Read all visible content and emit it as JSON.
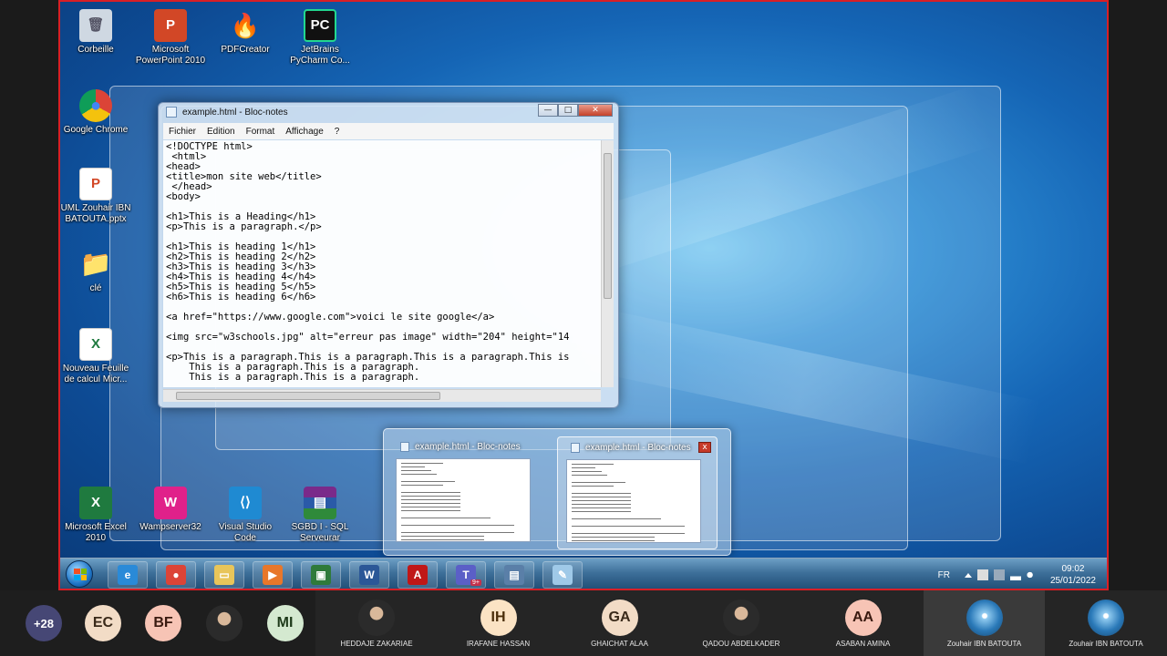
{
  "desktop": {
    "icons": [
      {
        "label": "Corbeille",
        "glyph": "🗑",
        "color": "#cfd8e2"
      },
      {
        "label": "Microsoft PowerPoint 2010",
        "glyph": "P",
        "color": "#d24726"
      },
      {
        "label": "PDFCreator",
        "glyph": "🔥",
        "color": "#c01717"
      },
      {
        "label": "JetBrains PyCharm Co...",
        "glyph": "PC",
        "color": "#1e1e1e"
      },
      {
        "label": "Google Chrome",
        "glyph": "●",
        "color": "#3b8de0"
      },
      {
        "label": "UML Zouhair IBN BATOUTA.pptx",
        "glyph": "P",
        "color": "#d24726"
      },
      {
        "label": "clé",
        "glyph": "📁",
        "color": "#e8c55a"
      },
      {
        "label": "Nouveau Feuille de calcul Micr...",
        "glyph": "X",
        "color": "#1f7a3f"
      },
      {
        "label": "Microsoft Excel 2010",
        "glyph": "X",
        "color": "#1f7a3f"
      },
      {
        "label": "Wampserver32",
        "glyph": "W",
        "color": "#e0218a"
      },
      {
        "label": "Visual Studio Code",
        "glyph": "⟨⟩",
        "color": "#1f8ad2"
      },
      {
        "label": "SGBD I - SQL Serveurar",
        "glyph": "▤",
        "color": "#7a2a8a"
      }
    ]
  },
  "notepad": {
    "title": "example.html - Bloc-notes",
    "menus": [
      "Fichier",
      "Edition",
      "Format",
      "Affichage",
      "?"
    ],
    "min_label": "—",
    "max_label": "□",
    "close_label": "✕",
    "content": "<!DOCTYPE html>\n <html>\n<head>\n<title>mon site web</title>\n </head>\n<body>\n\n<h1>This is a Heading</h1>\n<p>This is a paragraph.</p>\n\n<h1>This is heading 1</h1>\n<h2>This is heading 2</h2>\n<h3>This is heading 3</h3>\n<h4>This is heading 4</h4>\n<h5>This is heading 5</h5>\n<h6>This is heading 6</h6>\n\n<a href=\"https://www.google.com\">voici le site google</a>\n\n<img src=\"w3schools.jpg\" alt=\"erreur pas image\" width=\"204\" height=\"14\n\n<p>This is a paragraph.This is a paragraph.This is a paragraph.This is\n    This is a paragraph.This is a paragraph.\n    This is a paragraph.This is a paragraph."
  },
  "thumbnails": [
    {
      "title": "example.html - Bloc-notes"
    },
    {
      "title": "example.html - Bloc-notes",
      "close_label": "x"
    }
  ],
  "taskbar": {
    "apps": [
      {
        "name": "internet-explorer",
        "glyph": "e",
        "color": "#2a8ad8"
      },
      {
        "name": "google-chrome",
        "glyph": "●",
        "color": "#dc4437"
      },
      {
        "name": "file-explorer",
        "glyph": "▭",
        "color": "#e8c55a"
      },
      {
        "name": "media-player",
        "glyph": "▶",
        "color": "#e8772a"
      },
      {
        "name": "remote-console",
        "glyph": "▣",
        "color": "#2f7a3a"
      },
      {
        "name": "microsoft-word",
        "glyph": "W",
        "color": "#2b5797"
      },
      {
        "name": "pdf-reader",
        "glyph": "A",
        "color": "#c01717"
      },
      {
        "name": "microsoft-teams",
        "glyph": "T",
        "color": "#5b5fc7"
      },
      {
        "name": "network-tool",
        "glyph": "▤",
        "color": "#5a7fa8"
      },
      {
        "name": "notepad",
        "glyph": "✎",
        "color": "#9fc9e8"
      }
    ],
    "teams_badge": "9+",
    "lang": "FR",
    "time": "09:02",
    "date": "25/01/2022"
  },
  "meeting": {
    "overflow_count": "+28",
    "participants": [
      {
        "initials": "EC",
        "name": "",
        "bg": "#f2dcc6",
        "fg": "#3a2a1a"
      },
      {
        "initials": "BF",
        "name": "",
        "bg": "#f7c4b5",
        "fg": "#3a1a10"
      },
      {
        "initials": "",
        "name": "",
        "avatar": "photo"
      },
      {
        "initials": "MI",
        "name": "",
        "bg": "#d4e9d0",
        "fg": "#1e3a1a"
      },
      {
        "initials": "",
        "name": "HEDDAJE ZAKARIAE",
        "avatar": "photo"
      },
      {
        "initials": "IH",
        "name": "IRAFANE HASSAN",
        "bg": "#fbe3c4",
        "fg": "#4a2e0a"
      },
      {
        "initials": "GA",
        "name": "GHAICHAT ALAA",
        "bg": "#f2dcc6",
        "fg": "#3a2a1a"
      },
      {
        "initials": "",
        "name": "QADOU ABDELKADER",
        "avatar": "photo"
      },
      {
        "initials": "AA",
        "name": "ASABAN AMINA",
        "bg": "#f7c4b5",
        "fg": "#3a1a10"
      },
      {
        "initials": "",
        "name": "Zouhair IBN BATOUTA",
        "avatar": "globe"
      },
      {
        "initials": "",
        "name": "Zouhair IBN BATOUTA",
        "avatar": "globe"
      }
    ]
  }
}
